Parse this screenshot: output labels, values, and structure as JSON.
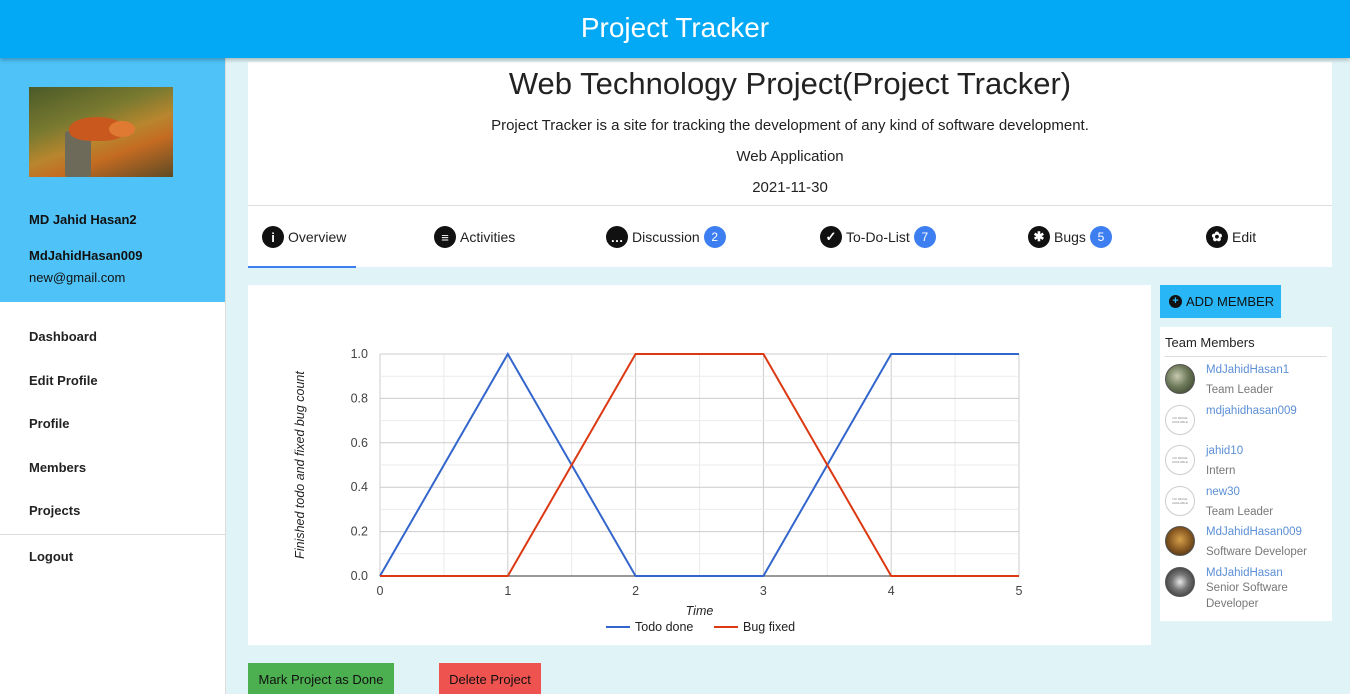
{
  "app_title": "Project Tracker",
  "user": {
    "full_name": "MD Jahid Hasan2",
    "username": "MdJahidHasan009",
    "email": "new@gmail.com"
  },
  "nav": {
    "items": [
      "Dashboard",
      "Edit Profile",
      "Profile",
      "Members",
      "Projects"
    ],
    "logout": "Logout"
  },
  "project": {
    "title": "Web Technology Project(Project Tracker)",
    "description": "Project Tracker is a site for tracking the development of any kind of software development.",
    "type": "Web Application",
    "date": "2021-11-30"
  },
  "tabs": [
    {
      "label": "Overview",
      "icon": "info-icon",
      "badge": ""
    },
    {
      "label": "Activities",
      "icon": "clipboard-icon",
      "badge": ""
    },
    {
      "label": "Discussion",
      "icon": "chat-icon",
      "badge": "2"
    },
    {
      "label": "To-Do-List",
      "icon": "check-circle-icon",
      "badge": "7"
    },
    {
      "label": "Bugs",
      "icon": "bug-icon",
      "badge": "5"
    },
    {
      "label": "Edit",
      "icon": "gear-icon",
      "badge": ""
    }
  ],
  "chart_data": {
    "type": "line",
    "x": [
      0,
      1,
      2,
      3,
      4,
      5
    ],
    "series": [
      {
        "name": "Todo done",
        "color": "#3366cc",
        "values": [
          0,
          1,
          0,
          0,
          1,
          1
        ]
      },
      {
        "name": "Bug fixed",
        "color": "#dc3912",
        "values": [
          0,
          0,
          1,
          1,
          0,
          0
        ]
      }
    ],
    "xlabel": "Time",
    "ylabel": "Finished todo and fixed bug count",
    "xlim": [
      0,
      5
    ],
    "ylim": [
      0,
      1
    ],
    "x_ticks": [
      "0",
      "1",
      "2",
      "3",
      "4",
      "5"
    ],
    "y_ticks": [
      "0.0",
      "0.2",
      "0.4",
      "0.6",
      "0.8",
      "1.0"
    ],
    "grid": true,
    "legend": "bottom"
  },
  "add_member_label": "ADD MEMBER",
  "team": {
    "title": "Team Members",
    "no_image_text": "NO IMAGE AVAILABLE",
    "members": [
      {
        "name": "MdJahidHasan1",
        "role": "Team Leader"
      },
      {
        "name": "mdjahidhasan009",
        "role": ""
      },
      {
        "name": "jahid10",
        "role": "Intern"
      },
      {
        "name": "new30",
        "role": "Team Leader"
      },
      {
        "name": "MdJahidHasan009",
        "role": "Software Developer"
      },
      {
        "name": "MdJahidHasan",
        "role": "Senior Software Developer"
      }
    ]
  },
  "buttons": {
    "mark_done": "Mark Project as Done",
    "delete": "Delete Project"
  }
}
